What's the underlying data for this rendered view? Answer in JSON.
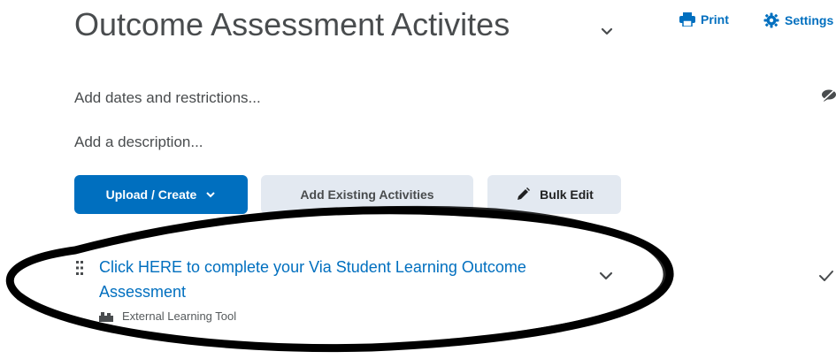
{
  "header": {
    "title": "Outcome Assessment Activites",
    "print_label": "Print",
    "settings_label": "Settings",
    "icons": [
      "chevron-down-icon",
      "printer-icon",
      "gear-icon"
    ]
  },
  "content": {
    "dates_link": "Add dates and restrictions...",
    "description_link": "Add a description..."
  },
  "toolbar": {
    "upload_label": "Upload / Create",
    "add_existing_label": "Add Existing Activities",
    "bulk_edit_label": "Bulk Edit"
  },
  "activity": {
    "title": "Click HERE to complete your Via Student Learning Outcome Assessment",
    "type_label": "External Learning Tool"
  },
  "colors": {
    "accent": "#006fbf",
    "secondary_button": "#e3e9f1",
    "title_text": "#494c4e"
  }
}
